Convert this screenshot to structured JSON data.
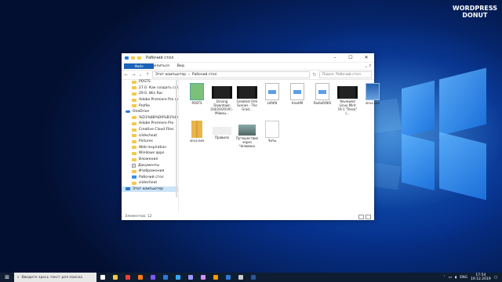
{
  "watermark": {
    "line1": "WORDPRESS",
    "line2": "DONUT"
  },
  "window": {
    "title": "Рабочий стол",
    "ribbon_tabs": [
      "Файл",
      "Главная",
      "Поделиться",
      "Вид"
    ],
    "address_parts": [
      "Этот компьютер",
      "Рабочий стол"
    ],
    "search_placeholder": "Поиск: Рабочий стол",
    "status": "Элементов: 12"
  },
  "nav_items": [
    {
      "label": "POSTS",
      "icon": "folder-icon",
      "level": 1
    },
    {
      "label": "27.0. Как создать сайт для...",
      "icon": "folder-icon",
      "level": 1
    },
    {
      "label": "29.0. Win Rar",
      "icon": "folder-icon",
      "level": 1
    },
    {
      "label": "Adobe Premiere Pro Auto-S...",
      "icon": "folder-icon",
      "level": 1
    },
    {
      "label": "Profile",
      "icon": "folder-icon",
      "level": 1
    },
    {
      "label": "OneDrive",
      "icon": "cloud-icon",
      "level": 0
    },
    {
      "label": "%D1%88%D0%B1%D0%BB...",
      "icon": "folder-icon",
      "level": 1
    },
    {
      "label": "Adobe Premiere Pro",
      "icon": "folder-icon",
      "level": 1
    },
    {
      "label": "Creative Cloud Files",
      "icon": "folder-icon",
      "level": 1
    },
    {
      "label": "slidecheat",
      "icon": "folder-icon",
      "level": 1
    },
    {
      "label": "Pictures",
      "icon": "folder-icon",
      "level": 1
    },
    {
      "label": "Web Inspiration",
      "icon": "folder-icon",
      "level": 1
    },
    {
      "label": "Windows apps",
      "icon": "folder-icon",
      "level": 1
    },
    {
      "label": "Вложения",
      "icon": "folder-icon",
      "level": 1
    },
    {
      "label": "Документы",
      "icon": "document-icon",
      "level": 1
    },
    {
      "label": "Изображения",
      "icon": "folder-icon",
      "level": 1
    },
    {
      "label": "Рабочий стол",
      "icon": "desktop-folder-icon",
      "level": 1
    },
    {
      "label": "slidecheat",
      "icon": "folder-icon",
      "level": 1
    },
    {
      "label": "Этот компьютер",
      "icon": "computer-icon",
      "level": 0,
      "selected": true
    }
  ],
  "files": [
    {
      "label": "POSTS",
      "thumb": "green"
    },
    {
      "label": "Driving Downtown [04/20/2019] - Milwau...",
      "thumb": "film"
    },
    {
      "label": "Greatest Film Scenes - The Grad...",
      "thumb": "film"
    },
    {
      "label": "Ldfdfd",
      "thumb": "page"
    },
    {
      "label": "KnoHM",
      "thumb": "page"
    },
    {
      "label": "RadioROKS",
      "thumb": "page"
    },
    {
      "label": "Reviewed Linux Mint 19.1 \"Tessa\" (...",
      "thumb": "film"
    },
    {
      "label": "virus.exe",
      "thumb": "blue"
    },
    {
      "label": "virus.exe",
      "thumb": "zip"
    },
    {
      "label": "Правила",
      "thumb": "light"
    },
    {
      "label": "Путешествие через Человека",
      "thumb": "img"
    },
    {
      "label": "Читы",
      "thumb": "blank"
    }
  ],
  "taskbar": {
    "search_placeholder": "Введите здесь текст для поиска",
    "apps": [
      {
        "icon": "task-view-icon",
        "color": "#ffffff"
      },
      {
        "icon": "file-explorer-icon",
        "color": "#f2c94c"
      },
      {
        "icon": "chrome-icon",
        "color": "#e94235"
      },
      {
        "icon": "firefox-icon",
        "color": "#ff7a1a"
      },
      {
        "icon": "viber-icon",
        "color": "#7a5af8"
      },
      {
        "icon": "store-icon",
        "color": "#2a7ad6"
      },
      {
        "icon": "photoshop-icon",
        "color": "#31a8ff"
      },
      {
        "icon": "premiere-icon",
        "color": "#9999ff"
      },
      {
        "icon": "after-effects-icon",
        "color": "#d291ff"
      },
      {
        "icon": "illustrator-icon",
        "color": "#ff9a00"
      },
      {
        "icon": "mail-icon",
        "color": "#2a7ad6"
      },
      {
        "icon": "obs-icon",
        "color": "#cccccc"
      },
      {
        "icon": "word-icon",
        "color": "#2b579a"
      }
    ],
    "lang": "ENG",
    "time": "17:54",
    "date": "19.12.2019"
  }
}
